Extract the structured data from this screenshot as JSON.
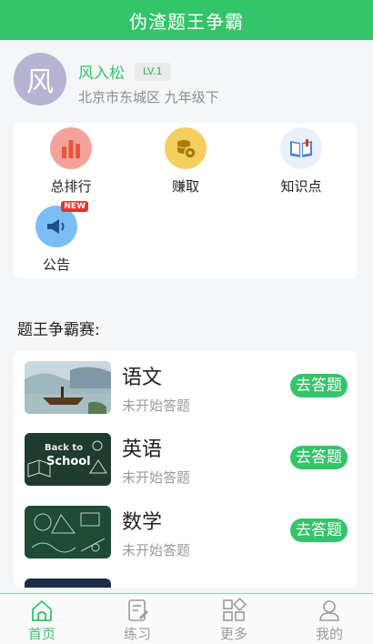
{
  "app": {
    "title": "伪渣题王争霸"
  },
  "profile": {
    "avatar_char": "风",
    "name": "风入松",
    "level": "LV.1",
    "location": "北京市东城区 九年级下"
  },
  "menu": {
    "rank": "总排行",
    "earn": "赚取",
    "knowledge": "知识点",
    "notice": "公告",
    "new_badge": "NEW"
  },
  "section": {
    "title": "题王争霸赛:"
  },
  "subjects": [
    {
      "name": "语文",
      "status": "未开始答题",
      "button": "去答题"
    },
    {
      "name": "英语",
      "status": "未开始答题",
      "button": "去答题"
    },
    {
      "name": "数学",
      "status": "未开始答题",
      "button": "去答题"
    }
  ],
  "thumb_text": {
    "english_line1": "Back to",
    "english_line2": "School"
  },
  "tabs": [
    {
      "label": "首页",
      "icon": "home-icon"
    },
    {
      "label": "练习",
      "icon": "practice-icon"
    },
    {
      "label": "更多",
      "icon": "grid-icon"
    },
    {
      "label": "我的",
      "icon": "user-icon"
    }
  ],
  "colors": {
    "brand": "#34c46a",
    "accent_red": "#e5342f"
  }
}
